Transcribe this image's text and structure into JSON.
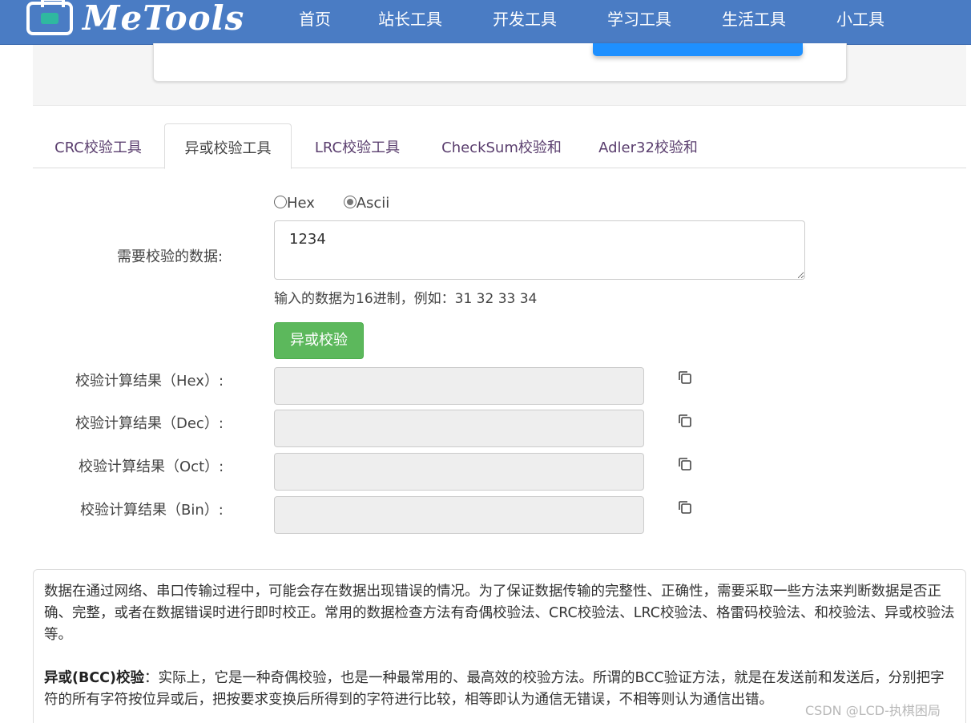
{
  "nav": {
    "logo_text": "MeTools",
    "items": [
      "首页",
      "站长工具",
      "开发工具",
      "学习工具",
      "生活工具",
      "小工具"
    ]
  },
  "tabs": [
    "CRC校验工具",
    "异或校验工具",
    "LRC校验工具",
    "CheckSum校验和",
    "Adler32校验和"
  ],
  "active_tab": "异或校验工具",
  "form": {
    "radio_hex": "Hex",
    "radio_ascii": "Ascii",
    "selected_radio": "Ascii",
    "data_label": "需要校验的数据:",
    "data_value": "1234",
    "hint": "输入的数据为16进制，例如：31 32 33 34",
    "submit_label": "异或校验",
    "results": [
      {
        "label": "校验计算结果（Hex）:",
        "value": ""
      },
      {
        "label": "校验计算结果（Dec）:",
        "value": ""
      },
      {
        "label": "校验计算结果（Oct）:",
        "value": ""
      },
      {
        "label": "校验计算结果（Bin）:",
        "value": ""
      }
    ]
  },
  "description": {
    "para1": "数据在通过网络、串口传输过程中，可能会存在数据出现错误的情况。为了保证数据传输的完整性、正确性，需要采取一些方法来判断数据是否正确、完整，或者在数据错误时进行即时校正。常用的数据检查方法有奇偶校验法、CRC校验法、LRC校验法、格雷码校验法、和校验法、异或校验法等。",
    "para2_title": "异或(BCC)校验",
    "para2_body": "：实际上，它是一种奇偶校验，也是一种最常用的、最高效的校验方法。所谓的BCC验证方法，就是在发送前和发送后，分别把字符的所有字符按位异或后，把按要求变换后所得到的字符进行比较，相等即认为通信无错误，不相等则认为通信出错。"
  },
  "watermark": "CSDN @LCD-执棋困局",
  "colors": {
    "navbar": "#4a7cc4",
    "button_green": "#5cb85c",
    "tab_text": "#5a3e6e",
    "accent_blue": "#1e90ff"
  }
}
